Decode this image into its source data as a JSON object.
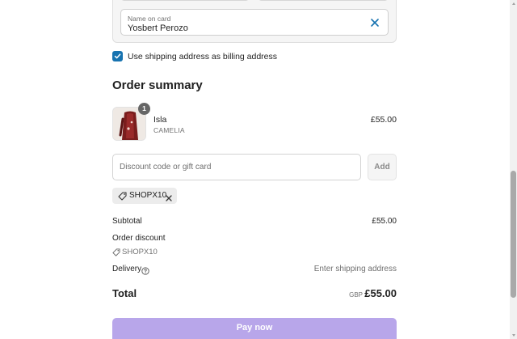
{
  "payment": {
    "name_label": "Name on card",
    "name_value": "Yosbert Perozo"
  },
  "billing": {
    "checkbox_label": "Use shipping address as billing address",
    "checked": true
  },
  "summary": {
    "title": "Order summary",
    "item": {
      "quantity": "1",
      "name": "Isla",
      "variant": "CAMELIA",
      "price": "£55.00"
    },
    "discount": {
      "placeholder": "Discount code or gift card",
      "add_label": "Add",
      "applied_code": "SHOPX10"
    },
    "subtotal_label": "Subtotal",
    "subtotal_value": "£55.00",
    "order_discount_label": "Order discount",
    "order_discount_code": "SHOPX10",
    "delivery_label": "Delivery",
    "delivery_value": "Enter shipping address",
    "total_label": "Total",
    "total_currency": "GBP",
    "total_value": "£55.00"
  },
  "actions": {
    "pay_label": "Pay now"
  },
  "colors": {
    "accent": "#1773b0",
    "pay_button": "#b8a6ea"
  }
}
